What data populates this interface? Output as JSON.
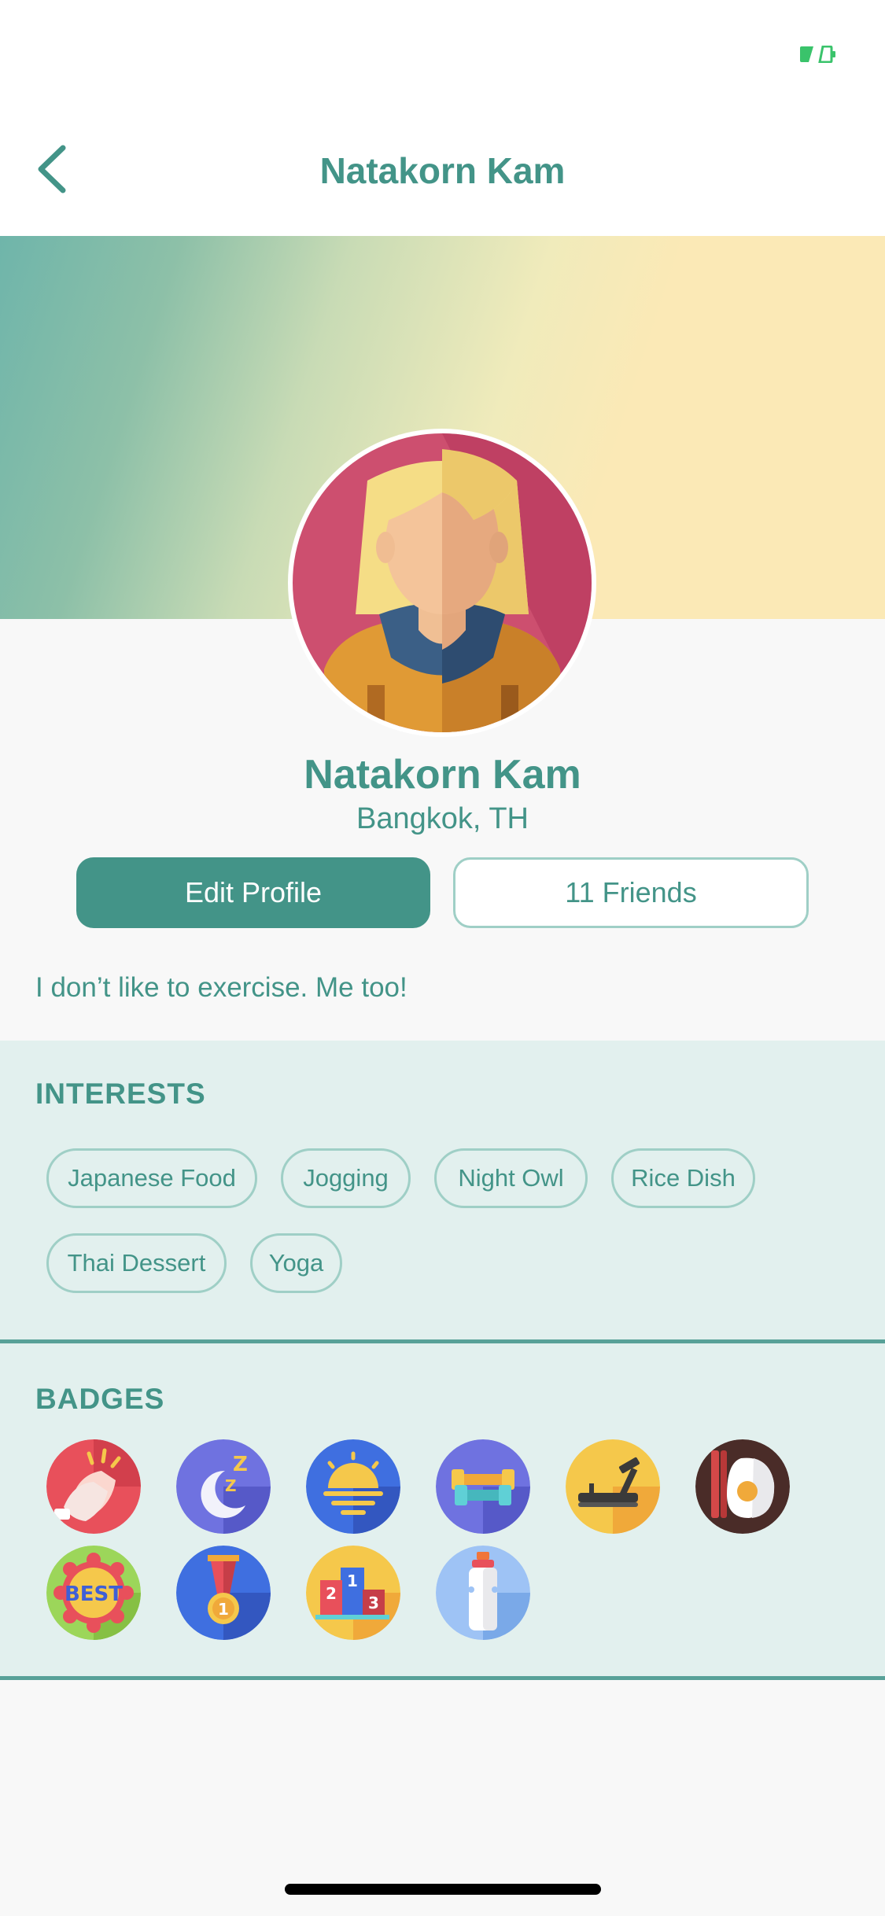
{
  "status_bar": {
    "battery_color": "#3ac36b"
  },
  "nav": {
    "back_icon": "chevron-left-icon",
    "title": "Natakorn Kam"
  },
  "colors": {
    "primary": "#439488",
    "hero_start": "#6fb5aa",
    "hero_end": "#fbe9b6",
    "section_bg": "#e2f0ee"
  },
  "profile": {
    "avatar": "female-avatar-icon",
    "name": "Natakorn Kam",
    "location": "Bangkok, TH",
    "edit_label": "Edit Profile",
    "friends_label": "11 Friends",
    "bio": "I don’t like to exercise. Me too!"
  },
  "interests": {
    "title": "INTERESTS",
    "tags": [
      "Japanese Food",
      "Jogging",
      "Night Owl",
      "Rice Dish",
      "Thai Dessert",
      "Yoga"
    ]
  },
  "badges": {
    "title": "BADGES",
    "items": [
      "clapping-hands-icon",
      "moon-sleep-icon",
      "sunrise-icon",
      "dumbbell-icon",
      "treadmill-icon",
      "fried-egg-bacon-icon",
      "best-award-icon",
      "gold-medal-icon",
      "podium-icon",
      "water-bottle-icon"
    ]
  }
}
